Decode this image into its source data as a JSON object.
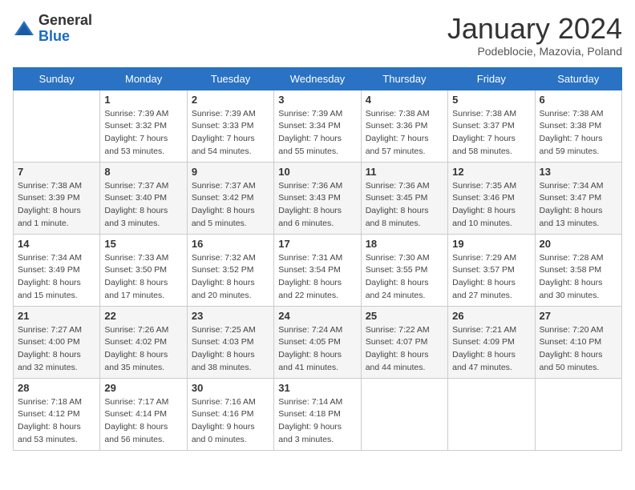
{
  "header": {
    "logo_line1": "General",
    "logo_line2": "Blue",
    "title": "January 2024",
    "subtitle": "Podeblocie, Mazovia, Poland"
  },
  "days_of_week": [
    "Sunday",
    "Monday",
    "Tuesday",
    "Wednesday",
    "Thursday",
    "Friday",
    "Saturday"
  ],
  "weeks": [
    [
      {
        "day": "",
        "info": []
      },
      {
        "day": "1",
        "info": [
          "Sunrise: 7:39 AM",
          "Sunset: 3:32 PM",
          "Daylight: 7 hours",
          "and 53 minutes."
        ]
      },
      {
        "day": "2",
        "info": [
          "Sunrise: 7:39 AM",
          "Sunset: 3:33 PM",
          "Daylight: 7 hours",
          "and 54 minutes."
        ]
      },
      {
        "day": "3",
        "info": [
          "Sunrise: 7:39 AM",
          "Sunset: 3:34 PM",
          "Daylight: 7 hours",
          "and 55 minutes."
        ]
      },
      {
        "day": "4",
        "info": [
          "Sunrise: 7:38 AM",
          "Sunset: 3:36 PM",
          "Daylight: 7 hours",
          "and 57 minutes."
        ]
      },
      {
        "day": "5",
        "info": [
          "Sunrise: 7:38 AM",
          "Sunset: 3:37 PM",
          "Daylight: 7 hours",
          "and 58 minutes."
        ]
      },
      {
        "day": "6",
        "info": [
          "Sunrise: 7:38 AM",
          "Sunset: 3:38 PM",
          "Daylight: 7 hours",
          "and 59 minutes."
        ]
      }
    ],
    [
      {
        "day": "7",
        "info": [
          "Sunrise: 7:38 AM",
          "Sunset: 3:39 PM",
          "Daylight: 8 hours",
          "and 1 minute."
        ]
      },
      {
        "day": "8",
        "info": [
          "Sunrise: 7:37 AM",
          "Sunset: 3:40 PM",
          "Daylight: 8 hours",
          "and 3 minutes."
        ]
      },
      {
        "day": "9",
        "info": [
          "Sunrise: 7:37 AM",
          "Sunset: 3:42 PM",
          "Daylight: 8 hours",
          "and 5 minutes."
        ]
      },
      {
        "day": "10",
        "info": [
          "Sunrise: 7:36 AM",
          "Sunset: 3:43 PM",
          "Daylight: 8 hours",
          "and 6 minutes."
        ]
      },
      {
        "day": "11",
        "info": [
          "Sunrise: 7:36 AM",
          "Sunset: 3:45 PM",
          "Daylight: 8 hours",
          "and 8 minutes."
        ]
      },
      {
        "day": "12",
        "info": [
          "Sunrise: 7:35 AM",
          "Sunset: 3:46 PM",
          "Daylight: 8 hours",
          "and 10 minutes."
        ]
      },
      {
        "day": "13",
        "info": [
          "Sunrise: 7:34 AM",
          "Sunset: 3:47 PM",
          "Daylight: 8 hours",
          "and 13 minutes."
        ]
      }
    ],
    [
      {
        "day": "14",
        "info": [
          "Sunrise: 7:34 AM",
          "Sunset: 3:49 PM",
          "Daylight: 8 hours",
          "and 15 minutes."
        ]
      },
      {
        "day": "15",
        "info": [
          "Sunrise: 7:33 AM",
          "Sunset: 3:50 PM",
          "Daylight: 8 hours",
          "and 17 minutes."
        ]
      },
      {
        "day": "16",
        "info": [
          "Sunrise: 7:32 AM",
          "Sunset: 3:52 PM",
          "Daylight: 8 hours",
          "and 20 minutes."
        ]
      },
      {
        "day": "17",
        "info": [
          "Sunrise: 7:31 AM",
          "Sunset: 3:54 PM",
          "Daylight: 8 hours",
          "and 22 minutes."
        ]
      },
      {
        "day": "18",
        "info": [
          "Sunrise: 7:30 AM",
          "Sunset: 3:55 PM",
          "Daylight: 8 hours",
          "and 24 minutes."
        ]
      },
      {
        "day": "19",
        "info": [
          "Sunrise: 7:29 AM",
          "Sunset: 3:57 PM",
          "Daylight: 8 hours",
          "and 27 minutes."
        ]
      },
      {
        "day": "20",
        "info": [
          "Sunrise: 7:28 AM",
          "Sunset: 3:58 PM",
          "Daylight: 8 hours",
          "and 30 minutes."
        ]
      }
    ],
    [
      {
        "day": "21",
        "info": [
          "Sunrise: 7:27 AM",
          "Sunset: 4:00 PM",
          "Daylight: 8 hours",
          "and 32 minutes."
        ]
      },
      {
        "day": "22",
        "info": [
          "Sunrise: 7:26 AM",
          "Sunset: 4:02 PM",
          "Daylight: 8 hours",
          "and 35 minutes."
        ]
      },
      {
        "day": "23",
        "info": [
          "Sunrise: 7:25 AM",
          "Sunset: 4:03 PM",
          "Daylight: 8 hours",
          "and 38 minutes."
        ]
      },
      {
        "day": "24",
        "info": [
          "Sunrise: 7:24 AM",
          "Sunset: 4:05 PM",
          "Daylight: 8 hours",
          "and 41 minutes."
        ]
      },
      {
        "day": "25",
        "info": [
          "Sunrise: 7:22 AM",
          "Sunset: 4:07 PM",
          "Daylight: 8 hours",
          "and 44 minutes."
        ]
      },
      {
        "day": "26",
        "info": [
          "Sunrise: 7:21 AM",
          "Sunset: 4:09 PM",
          "Daylight: 8 hours",
          "and 47 minutes."
        ]
      },
      {
        "day": "27",
        "info": [
          "Sunrise: 7:20 AM",
          "Sunset: 4:10 PM",
          "Daylight: 8 hours",
          "and 50 minutes."
        ]
      }
    ],
    [
      {
        "day": "28",
        "info": [
          "Sunrise: 7:18 AM",
          "Sunset: 4:12 PM",
          "Daylight: 8 hours",
          "and 53 minutes."
        ]
      },
      {
        "day": "29",
        "info": [
          "Sunrise: 7:17 AM",
          "Sunset: 4:14 PM",
          "Daylight: 8 hours",
          "and 56 minutes."
        ]
      },
      {
        "day": "30",
        "info": [
          "Sunrise: 7:16 AM",
          "Sunset: 4:16 PM",
          "Daylight: 9 hours",
          "and 0 minutes."
        ]
      },
      {
        "day": "31",
        "info": [
          "Sunrise: 7:14 AM",
          "Sunset: 4:18 PM",
          "Daylight: 9 hours",
          "and 3 minutes."
        ]
      },
      {
        "day": "",
        "info": []
      },
      {
        "day": "",
        "info": []
      },
      {
        "day": "",
        "info": []
      }
    ]
  ]
}
